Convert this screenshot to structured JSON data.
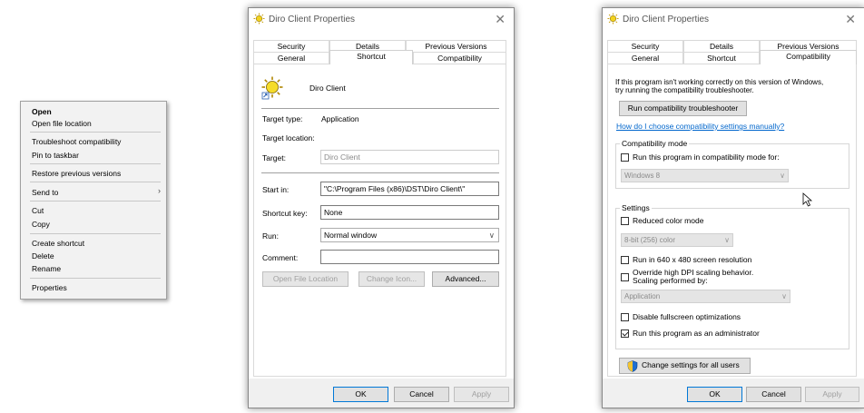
{
  "context_menu": {
    "items": [
      {
        "label": "Open",
        "bold": true
      },
      {
        "label": "Open file location"
      },
      {
        "label": "Troubleshoot compatibility"
      },
      {
        "label": "Pin to taskbar"
      },
      {
        "label": "Restore previous versions"
      },
      {
        "label": "Send to",
        "submenu": true
      },
      {
        "label": "Cut"
      },
      {
        "label": "Copy"
      },
      {
        "label": "Create shortcut"
      },
      {
        "label": "Delete"
      },
      {
        "label": "Rename"
      },
      {
        "label": "Properties"
      }
    ],
    "submenu_icon": "chevron-right-icon"
  },
  "dialog1": {
    "title": "Diro Client Properties",
    "close": "✕",
    "tabs_row1": [
      "Security",
      "Details",
      "Previous Versions"
    ],
    "tabs_row2": [
      "General",
      "Shortcut",
      "Compatibility"
    ],
    "active_tab": "Shortcut",
    "app_name": "Diro Client",
    "target_type_label": "Target type:",
    "target_type_value": "Application",
    "target_location_label": "Target location:",
    "target_label": "Target:",
    "target_value": "Diro Client",
    "start_in_label": "Start in:",
    "start_in_value": "\"C:\\Program Files (x86)\\DST\\Diro Client\\\"",
    "shortcut_key_label": "Shortcut key:",
    "shortcut_key_value": "None",
    "run_label": "Run:",
    "run_value": "Normal window",
    "comment_label": "Comment:",
    "comment_value": "",
    "open_file_location": "Open File Location",
    "change_icon": "Change Icon...",
    "advanced": "Advanced...",
    "ok": "OK",
    "cancel": "Cancel",
    "apply": "Apply"
  },
  "dialog2": {
    "title": "Diro Client Properties",
    "close": "✕",
    "tabs_row1": [
      "Security",
      "Details",
      "Previous Versions"
    ],
    "tabs_row2": [
      "General",
      "Shortcut",
      "Compatibility"
    ],
    "active_tab": "Compatibility",
    "intro_line1": "If this program isn't working correctly on this version of Windows,",
    "intro_line2": "try running the compatibility troubleshooter.",
    "run_troubleshooter": "Run compatibility troubleshooter",
    "how_link": "How do I choose compatibility settings manually?",
    "compat_mode_group": "Compatibility mode",
    "compat_mode_check": "Run this program in compatibility mode for:",
    "compat_mode_value": "Windows 8",
    "settings_group": "Settings",
    "reduced_color": "Reduced color mode",
    "color_value": "8-bit (256) color",
    "res_640": "Run in 640 x 480 screen resolution",
    "dpi_line1": "Override high DPI scaling behavior.",
    "dpi_line2": "Scaling performed by:",
    "dpi_value": "Application",
    "disable_fullscreen": "Disable fullscreen optimizations",
    "run_admin": "Run this program as an administrator",
    "run_admin_checked": true,
    "change_all_users": "Change settings for all users",
    "ok": "OK",
    "cancel": "Cancel",
    "apply": "Apply"
  }
}
